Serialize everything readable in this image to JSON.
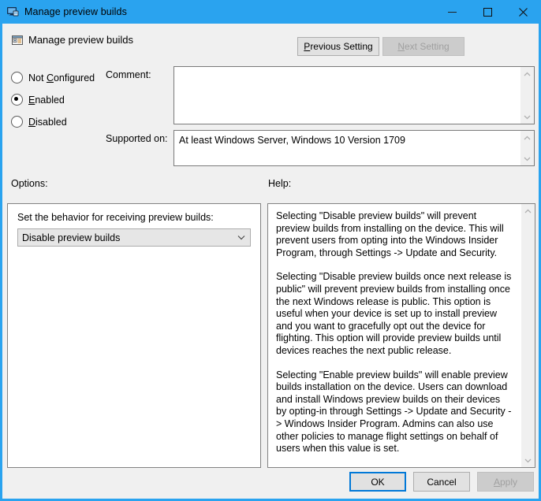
{
  "window": {
    "title": "Manage preview builds",
    "title_icon": "computer-monitor-icon",
    "accent_color": "#2aa3ef",
    "caption": {
      "minimize": "minimize-icon",
      "maximize": "maximize-icon",
      "close": "close-icon"
    }
  },
  "header": {
    "policy_title": "Manage preview builds",
    "policy_icon": "policy-setting-icon",
    "previous_setting": "Previous Setting",
    "previous_setting_accel": "P",
    "next_setting": "Next Setting",
    "next_setting_accel": "N",
    "next_setting_enabled": false
  },
  "state": {
    "options": [
      {
        "label": "Not Configured",
        "accel": "C",
        "selected": false
      },
      {
        "label": "Enabled",
        "accel": "E",
        "selected": true
      },
      {
        "label": "Disabled",
        "accel": "D",
        "selected": false
      }
    ]
  },
  "comment": {
    "label": "Comment:",
    "value": ""
  },
  "supported": {
    "label": "Supported on:",
    "value": "At least Windows Server, Windows 10 Version 1709"
  },
  "options_panel": {
    "label": "Options:",
    "setting_label": "Set the behavior for receiving preview builds:",
    "dropdown_value": "Disable preview builds"
  },
  "help_panel": {
    "label": "Help:",
    "paragraphs": [
      "Selecting \"Disable preview builds\" will prevent preview builds from installing on the device. This will prevent users from opting into the Windows Insider Program, through Settings -> Update and Security.",
      "Selecting \"Disable preview builds once next release is public\" will prevent preview builds from installing once the next Windows release is public. This option is useful when your device is set up to install preview and you want to gracefully opt out the device for flighting. This option will provide preview builds until devices reaches the next public release.",
      "Selecting \"Enable preview builds\" will enable preview builds installation on the device. Users can download and install Windows preview builds on their devices by opting-in through Settings -> Update and Security -> Windows Insider Program. Admins can also use other policies to manage flight settings on behalf of users when this value is set."
    ]
  },
  "footer": {
    "ok": "OK",
    "cancel": "Cancel",
    "apply": "Apply",
    "apply_accel": "A",
    "apply_enabled": false
  }
}
